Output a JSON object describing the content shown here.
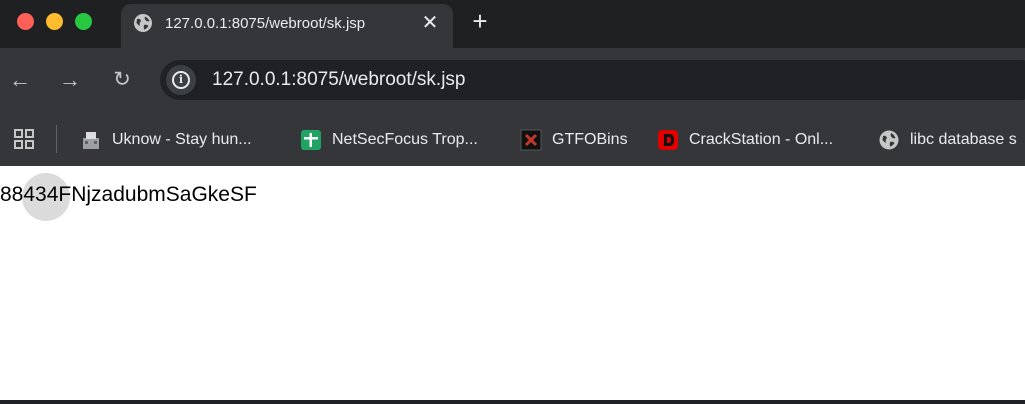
{
  "window": {
    "colors": {
      "close": "#fe5f57",
      "minimize": "#febc2e",
      "maximize": "#28c840",
      "chrome_dark": "#1f2022",
      "chrome_tab": "#35363a"
    }
  },
  "tab": {
    "title": "127.0.0.1:8075/webroot/sk.jsp",
    "favicon": "globe-icon",
    "close_glyph": "✕"
  },
  "newtab": {
    "glyph": "+"
  },
  "toolbar": {
    "back_glyph": "←",
    "forward_glyph": "→",
    "reload_glyph": "↻"
  },
  "omnibox": {
    "info_glyph": "i",
    "url": "127.0.0.1:8075/webroot/sk.jsp"
  },
  "bookmarks": [
    {
      "label": "Uknow - Stay hun...",
      "icon": "uknow-favicon"
    },
    {
      "label": "NetSecFocus Trop...",
      "icon": "spreadsheet-icon"
    },
    {
      "label": "GTFOBins",
      "icon": "gtfobins-icon"
    },
    {
      "label": "CrackStation - Onl...",
      "icon": "crackstation-icon"
    },
    {
      "label": "libc database s",
      "icon": "globe-icon"
    }
  ],
  "page": {
    "text": "88434FNjzadubmSaGkeSF"
  }
}
